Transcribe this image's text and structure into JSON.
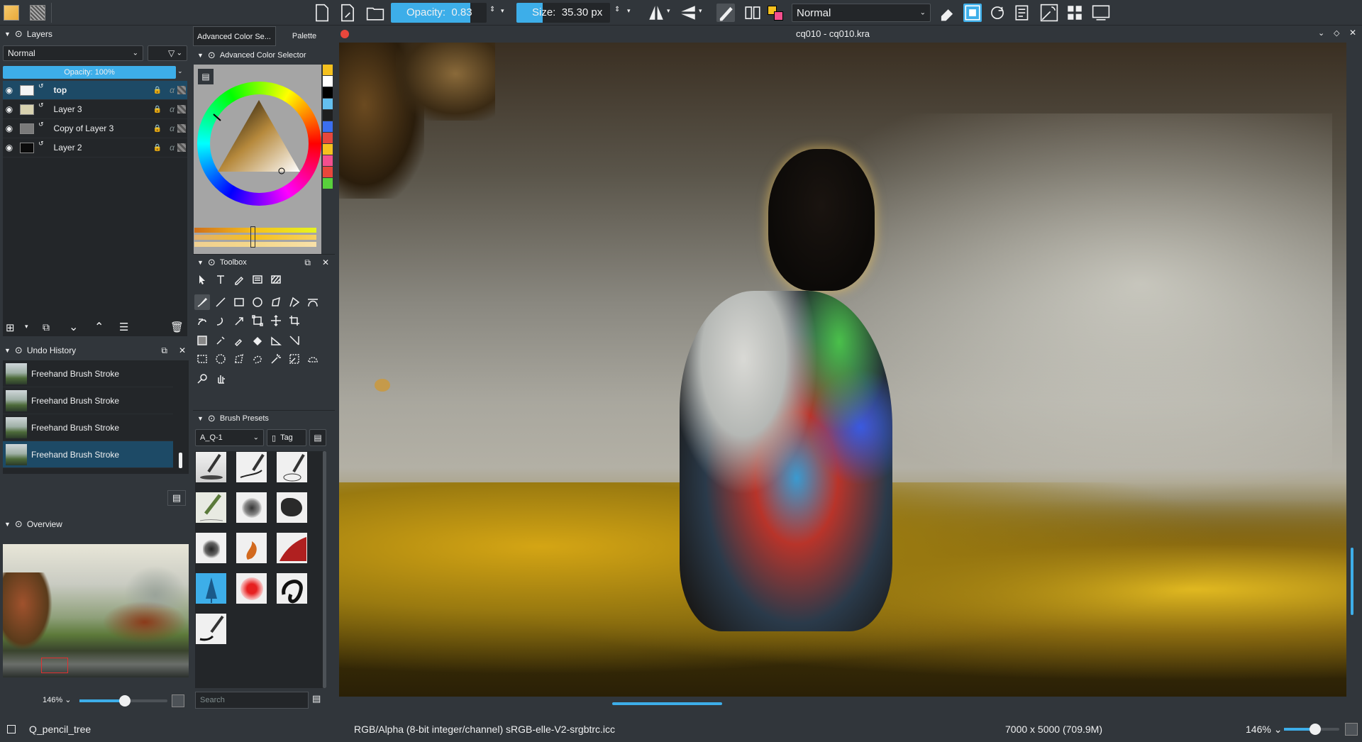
{
  "toolbar": {
    "opacity_label": "Opacity:",
    "opacity_value": "0.83",
    "opacity_fraction": 0.83,
    "size_label": "Size:",
    "size_value": "35.30 px",
    "blend_mode": "Normal"
  },
  "layers": {
    "title": "Layers",
    "blend_mode": "Normal",
    "opacity": "Opacity:  100%",
    "items": [
      {
        "name": "top",
        "selected": true
      },
      {
        "name": "Layer 3",
        "selected": false
      },
      {
        "name": "Copy of Layer 3",
        "selected": false
      },
      {
        "name": "Layer 2",
        "selected": false
      }
    ]
  },
  "undo": {
    "title": "Undo History",
    "items": [
      {
        "label": "Freehand Brush Stroke"
      },
      {
        "label": "Freehand Brush Stroke"
      },
      {
        "label": "Freehand Brush Stroke"
      },
      {
        "label": "Freehand Brush Stroke"
      }
    ]
  },
  "overview": {
    "title": "Overview",
    "zoom": "146%"
  },
  "color": {
    "tab_selector": "Advanced Color Se...",
    "tab_palette": "Palette",
    "title": "Advanced Color Selector",
    "swatches": [
      "#f5c11e",
      "#ffffff",
      "#000000",
      "#64c0f0",
      "#1e1e1e",
      "#3b6ff0",
      "#e8473c",
      "#f5c11e",
      "#f34f8e",
      "#e8473c",
      "#58d13c"
    ]
  },
  "toolbox": {
    "title": "Toolbox"
  },
  "brushes": {
    "title": "Brush Presets",
    "filter": "A_Q-1",
    "tag_label": "Tag",
    "search_placeholder": "Search"
  },
  "document": {
    "title": "cq010 - cq010.kra"
  },
  "status": {
    "brush_name": "Q_pencil_tree",
    "color_space": "RGB/Alpha (8-bit integer/channel)  sRGB-elle-V2-srgbtrc.icc",
    "image_size": "7000 x 5000 (709.9M)",
    "zoom": "146%"
  }
}
